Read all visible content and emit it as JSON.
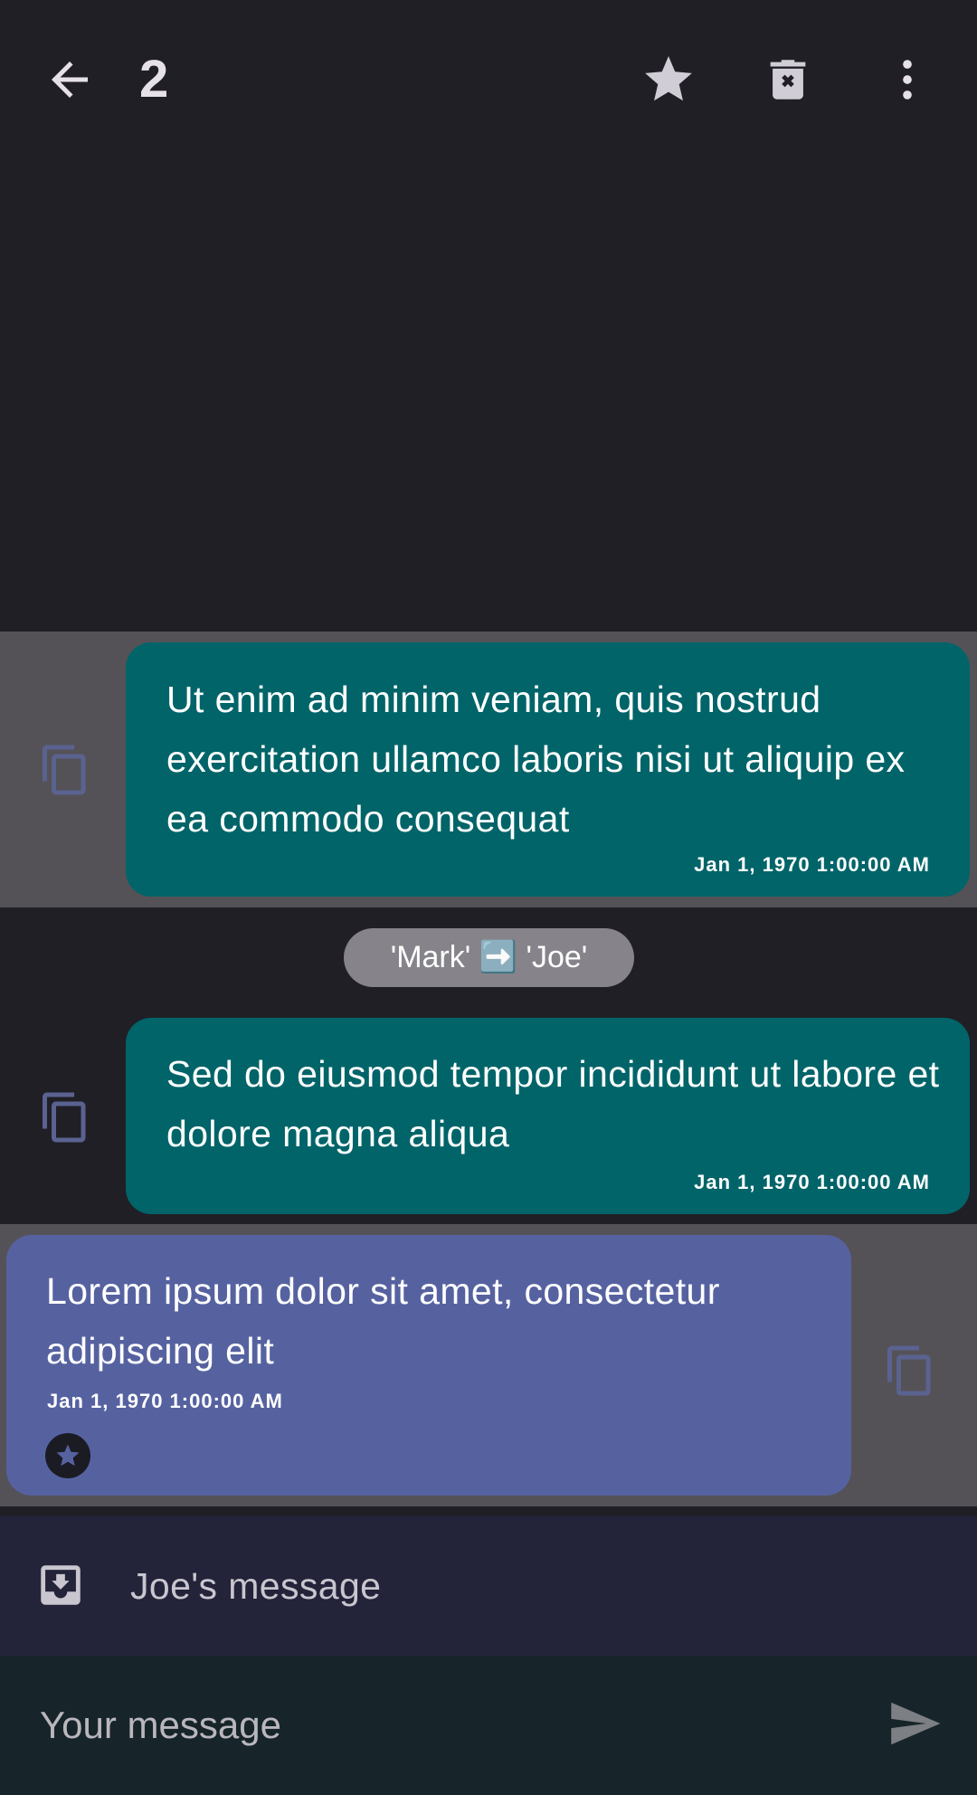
{
  "header": {
    "selected_count": "2",
    "icons": [
      "back-arrow-icon",
      "star-icon",
      "delete-icon",
      "more-vert-icon"
    ]
  },
  "messages": [
    {
      "direction": "outgoing",
      "selected": true,
      "text": "Ut enim ad minim veniam, quis nostrud exercitation ullamco laboris nisi ut aliquip ex ea commodo consequat",
      "time": "Jan 1, 1970 1:00:00 AM"
    },
    {
      "direction": "system",
      "text": "'Mark' ➡️ 'Joe'"
    },
    {
      "direction": "outgoing",
      "selected": false,
      "text": "Sed do eiusmod tempor incididunt ut labore et dolore magna aliqua",
      "time": "Jan 1, 1970 1:00:00 AM"
    },
    {
      "direction": "incoming",
      "selected": true,
      "starred": true,
      "text": "Lorem ipsum dolor sit amet, consectetur adipiscing elit",
      "time": "Jan 1, 1970 1:00:00 AM"
    }
  ],
  "reply_bar": {
    "label": "Joe's message"
  },
  "composer": {
    "placeholder": "Your message"
  },
  "colors": {
    "background": "#201f25",
    "selected_row": "#545257",
    "outgoing_bubble": "#006469",
    "incoming_bubble": "#5662a0",
    "system_pill": "#86848a",
    "reply_bar": "#23233a",
    "composer_bar": "#17252a",
    "copy_icon": "#5a6290"
  }
}
